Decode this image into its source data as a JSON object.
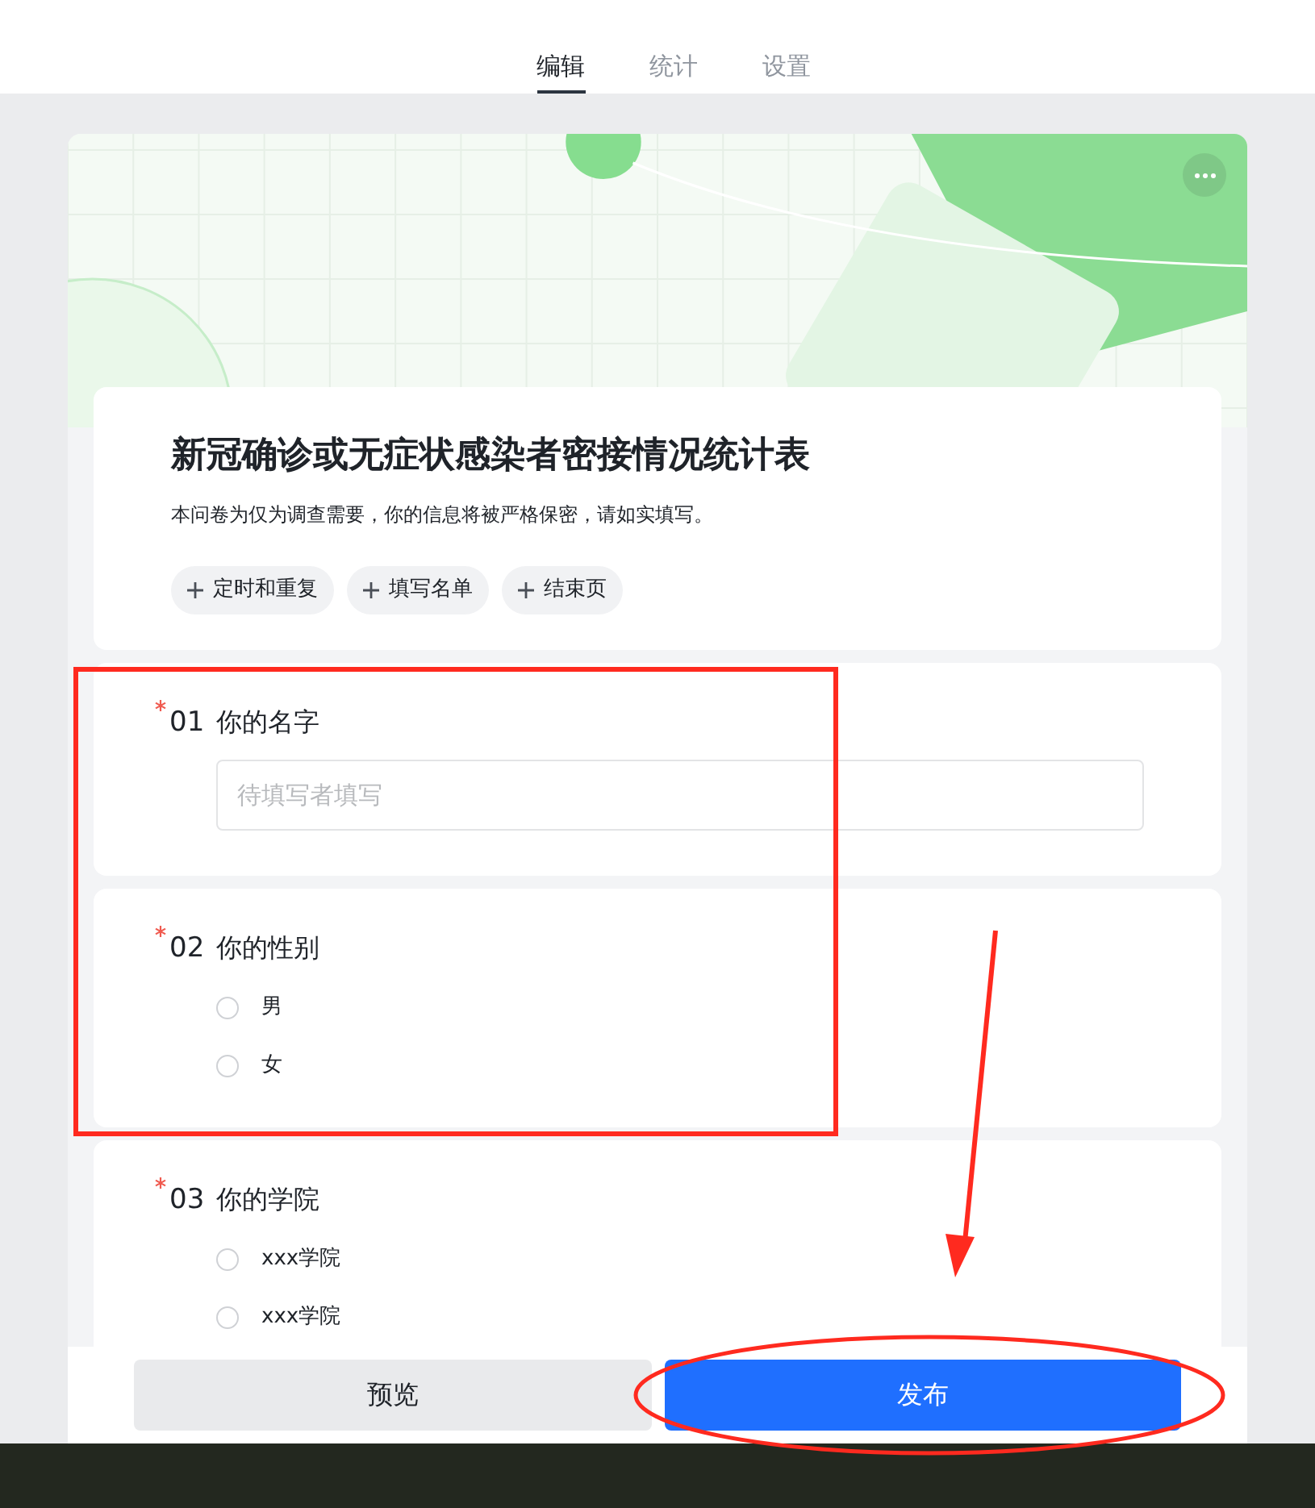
{
  "tabs": [
    {
      "label": "编辑",
      "selected": true
    },
    {
      "label": "统计",
      "selected": false
    },
    {
      "label": "设置",
      "selected": false
    }
  ],
  "form": {
    "title": "新冠确诊或无症状感染者密接情况统计表",
    "description": "本问卷为仅为调查需要，你的信息将被严格保密，请如实填写。",
    "chips": [
      {
        "label": "定时和重复"
      },
      {
        "label": "填写名单"
      },
      {
        "label": "结束页"
      }
    ]
  },
  "questions": [
    {
      "kind": "text",
      "required": true,
      "number": "01",
      "label": "你的名字",
      "placeholder": "待填写者填写"
    },
    {
      "kind": "choice",
      "required": true,
      "number": "02",
      "label": "你的性别",
      "options": [
        {
          "label": "男",
          "selected": false
        },
        {
          "label": "女",
          "selected": false
        }
      ]
    },
    {
      "kind": "choice",
      "required": true,
      "number": "03",
      "label": "你的学院",
      "options": [
        {
          "label": "xxx学院",
          "selected": false
        },
        {
          "label": "xxx学院",
          "selected": false
        }
      ]
    }
  ],
  "buttons": [
    {
      "label": "预览",
      "kind": "secondary"
    },
    {
      "label": "发布",
      "kind": "primary"
    }
  ]
}
